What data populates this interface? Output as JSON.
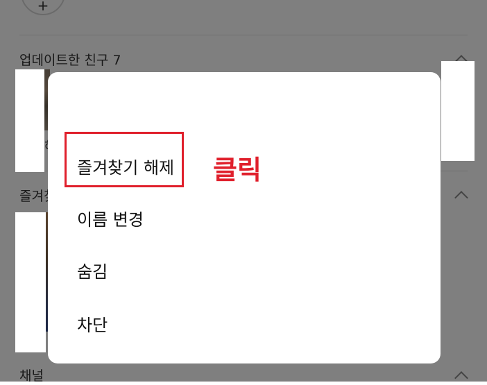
{
  "background": {
    "top_partial_glyph": "+",
    "sections": [
      {
        "label": "업데이트한 친구 7"
      },
      {
        "label": "즐겨찾"
      },
      {
        "label": "채널"
      }
    ],
    "peek_char": "해"
  },
  "menu": {
    "items": [
      {
        "label": "즐겨찾기 해제"
      },
      {
        "label": "이름 변경"
      },
      {
        "label": "숨김"
      },
      {
        "label": "차단"
      }
    ]
  },
  "annotation": {
    "text": "클릭",
    "color": "#e0202c"
  }
}
